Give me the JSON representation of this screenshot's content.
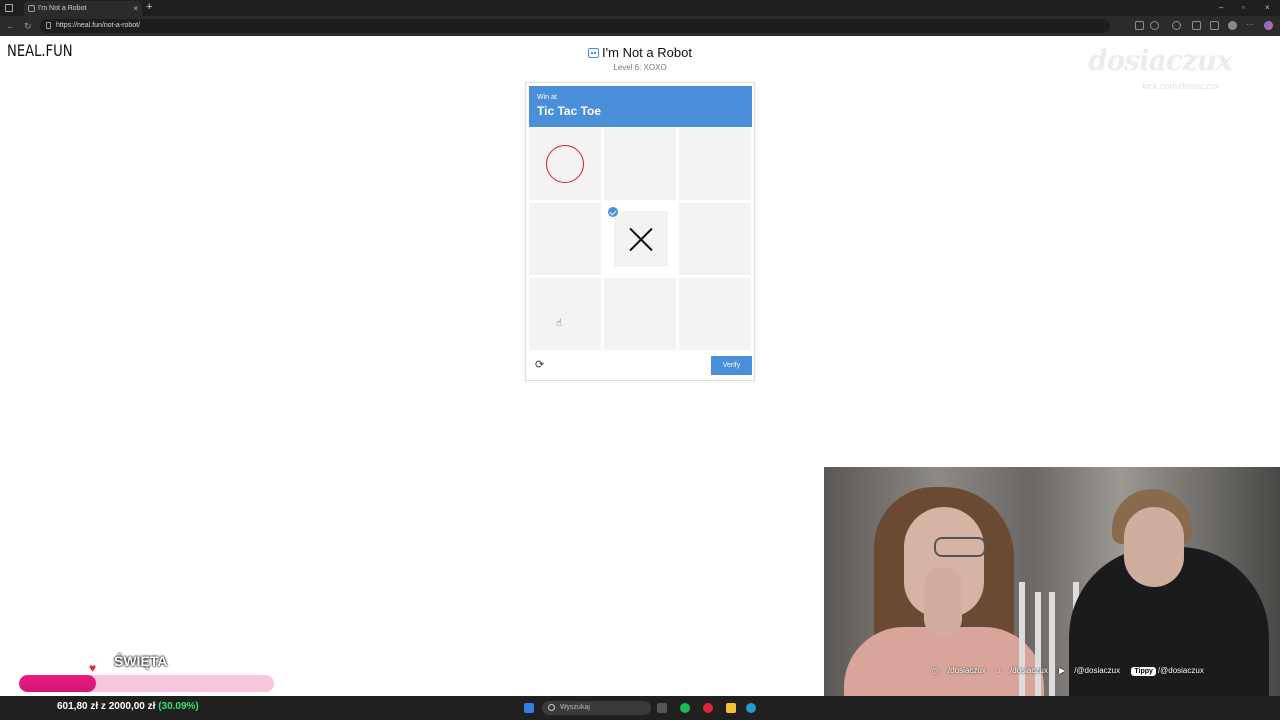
{
  "browser": {
    "tab_title": "I'm Not a Robot",
    "tab_close": "×",
    "new_tab": "+",
    "url": "https://neal.fun/not-a-robot/",
    "window_controls": [
      "–",
      "▫",
      "×"
    ]
  },
  "page": {
    "logo": "NEAL.FUN",
    "title": "I'm Not a Robot",
    "subtitle": "Level 6: XOXO"
  },
  "captcha": {
    "header_small": "Win at",
    "header_big": "Tic Tac Toe",
    "cells": [
      "O",
      "",
      "",
      "",
      "X",
      "",
      "",
      "",
      ""
    ],
    "selected_cell": 4,
    "verify_label": "Verify",
    "refresh_icon": "⟳"
  },
  "overlay": {
    "title": "ŚWIĘTA",
    "progress_fraction": 0.3009,
    "money_text": "601,80 zł z 2000,00 zł",
    "money_pct": "(30.09%)",
    "watermark": "dosiaczux",
    "socials": {
      "instagram": "/dosiaczux",
      "tiktok": "/dosiaczux",
      "youtube": "/@dosiaczux",
      "tippy_badge": "Tippy",
      "tippy": "/@dosiaczux"
    }
  },
  "taskbar": {
    "search_placeholder": "Wyszukaj"
  },
  "colors": {
    "accent": "#4a8fd9",
    "o_mark": "#d6202a",
    "progress_fill": "#e81c80",
    "progress_bg": "#f7c6de",
    "pct_green": "#2ee56b"
  }
}
